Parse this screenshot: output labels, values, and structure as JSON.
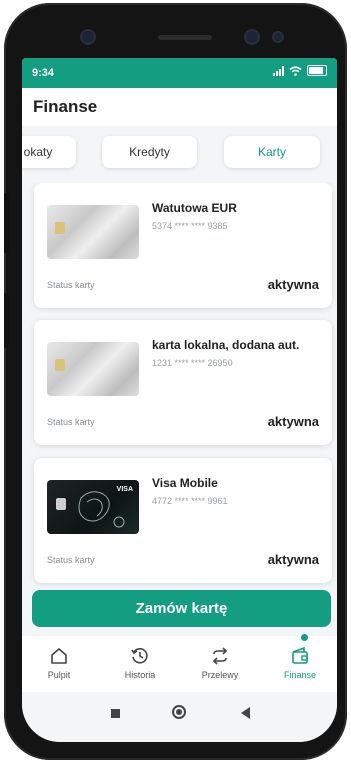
{
  "status_bar": {
    "time": "9:34"
  },
  "header": {
    "title": "Finanse"
  },
  "tabs": [
    {
      "label": "okaty"
    },
    {
      "label": "Kredyty"
    },
    {
      "label": "Karty"
    }
  ],
  "cards": [
    {
      "name": "Watutowa EUR",
      "number": "5374 **** **** 9385",
      "status_label": "Status karty",
      "status_value": "aktywna"
    },
    {
      "name": "karta lokalna, dodana aut.",
      "number": "1231 **** **** 26950",
      "status_label": "Status karty",
      "status_value": "aktywna"
    },
    {
      "name": "Visa Mobile",
      "number": "4772 **** **** 9961",
      "status_label": "Status karty",
      "status_value": "aktywna",
      "card_brand": "VISA"
    }
  ],
  "order_button": {
    "label": "Zamów kartę"
  },
  "bottom_nav": [
    {
      "label": "Pulpit",
      "icon": "home-icon"
    },
    {
      "label": "Historia",
      "icon": "history-icon"
    },
    {
      "label": "Przelewy",
      "icon": "transfer-icon"
    },
    {
      "label": "Finanse",
      "icon": "wallet-icon"
    }
  ],
  "colors": {
    "accent": "#139d81",
    "background": "#f4f5f7",
    "frame": "#141414"
  }
}
